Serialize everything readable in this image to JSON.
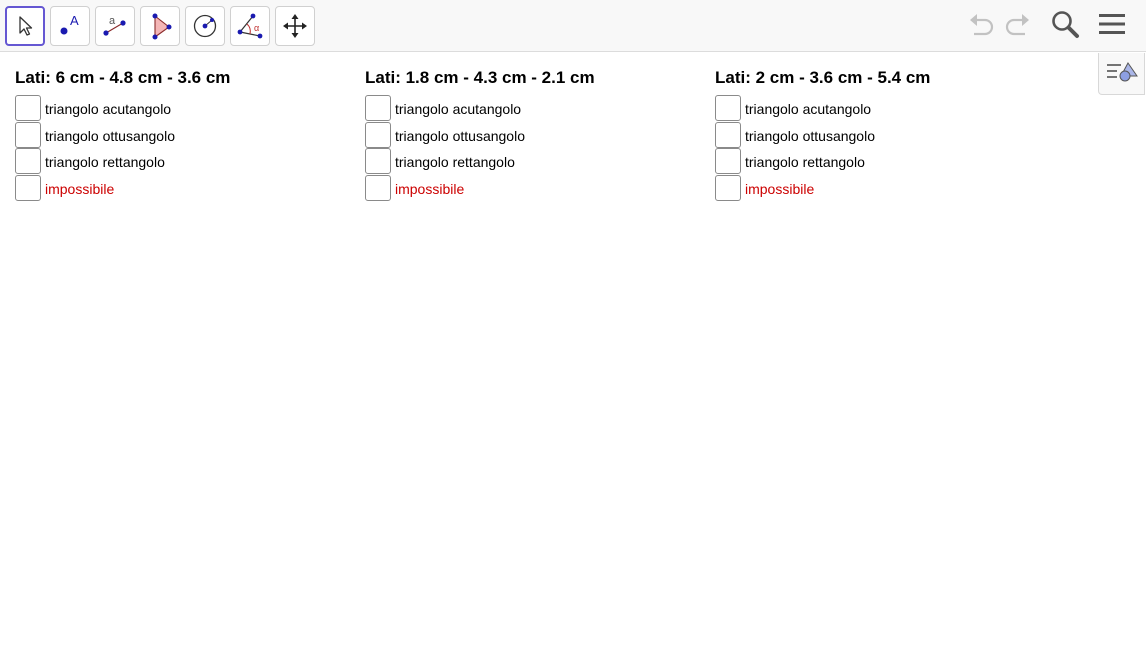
{
  "toolbar": {
    "tools": [
      {
        "name": "move-tool",
        "icon": "cursor-arrow-icon",
        "active": true
      },
      {
        "name": "point-tool",
        "icon": "point-icon",
        "icon_text": "A"
      },
      {
        "name": "segment-tool",
        "icon": "segment-icon",
        "icon_text": "a"
      },
      {
        "name": "polygon-tool",
        "icon": "polygon-icon"
      },
      {
        "name": "circle-tool",
        "icon": "circle-center-point-icon"
      },
      {
        "name": "angle-tool",
        "icon": "angle-icon",
        "icon_text": "α"
      },
      {
        "name": "move-graphics-view-tool",
        "icon": "move-arrows-icon"
      }
    ],
    "right": [
      "undo-icon",
      "redo-icon",
      "search-icon",
      "menu-icon"
    ]
  },
  "algebra_toggle": {
    "icon": "algebra-view-icon"
  },
  "groups": [
    {
      "title": "Lati: 6 cm - 4.8 cm - 3.6 cm",
      "options": [
        "triangolo acutangolo",
        "triangolo ottusangolo",
        "triangolo rettangolo",
        "impossibile"
      ]
    },
    {
      "title": "Lati: 1.8 cm - 4.3 cm - 2.1 cm",
      "options": [
        "triangolo acutangolo",
        "triangolo ottusangolo",
        "triangolo rettangolo",
        "impossibile"
      ]
    },
    {
      "title": "Lati: 2 cm - 3.6 cm - 5.4 cm",
      "options": [
        "triangolo acutangolo",
        "triangolo ottusangolo",
        "triangolo rettangolo",
        "impossibile"
      ]
    }
  ],
  "colors": {
    "accent": "#6557d2",
    "point_blue": "#1a1ab0",
    "impossible_text": "#cc0000",
    "polygon_fill": "#f4b6b6"
  }
}
